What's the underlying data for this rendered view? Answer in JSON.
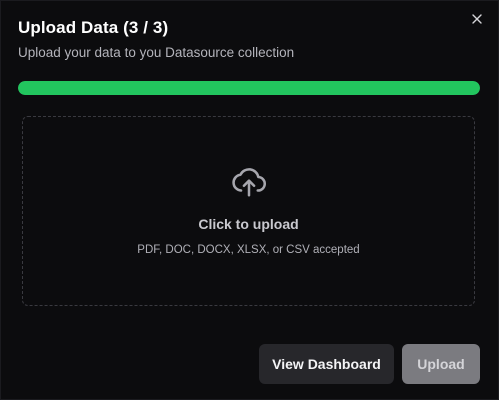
{
  "dialog": {
    "title": "Upload Data (3 / 3)",
    "subtitle": "Upload your data to you Datasource collection",
    "close_icon": "close-icon"
  },
  "progress": {
    "value_fraction": 1.0,
    "color": "#22c55e"
  },
  "dropzone": {
    "icon": "cloud-upload-icon",
    "title": "Click to upload",
    "hint": "PDF, DOC, DOCX, XLSX, or CSV accepted"
  },
  "actions": {
    "view_dashboard_label": "View Dashboard",
    "upload_label": "Upload",
    "upload_disabled": true
  }
}
